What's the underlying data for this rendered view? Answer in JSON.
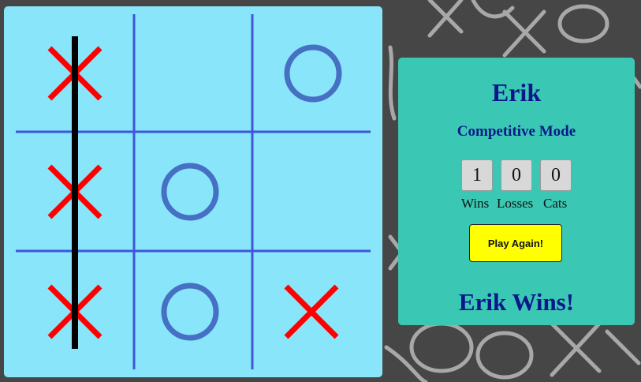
{
  "board": {
    "cells": [
      "X",
      "",
      "O",
      "X",
      "O",
      "",
      "X",
      "O",
      "X"
    ],
    "winning_line": "column-1",
    "colors": {
      "background": "#89e5fa",
      "grid": "#3f55dd",
      "x_mark": "#ff0000",
      "o_mark": "#4570c4",
      "win_line": "#000000"
    }
  },
  "panel": {
    "player_name": "Erik",
    "mode": "Competitive Mode",
    "scores": [
      {
        "value": "1",
        "label": "Wins"
      },
      {
        "value": "0",
        "label": "Losses"
      },
      {
        "value": "0",
        "label": "Cats"
      }
    ],
    "play_again_label": "Play Again!",
    "result": "Erik Wins!"
  },
  "colors": {
    "panel_bg": "#3ac8b5",
    "text_accent": "#0b1789",
    "button_bg": "#ffff00",
    "page_bg": "#464646"
  }
}
